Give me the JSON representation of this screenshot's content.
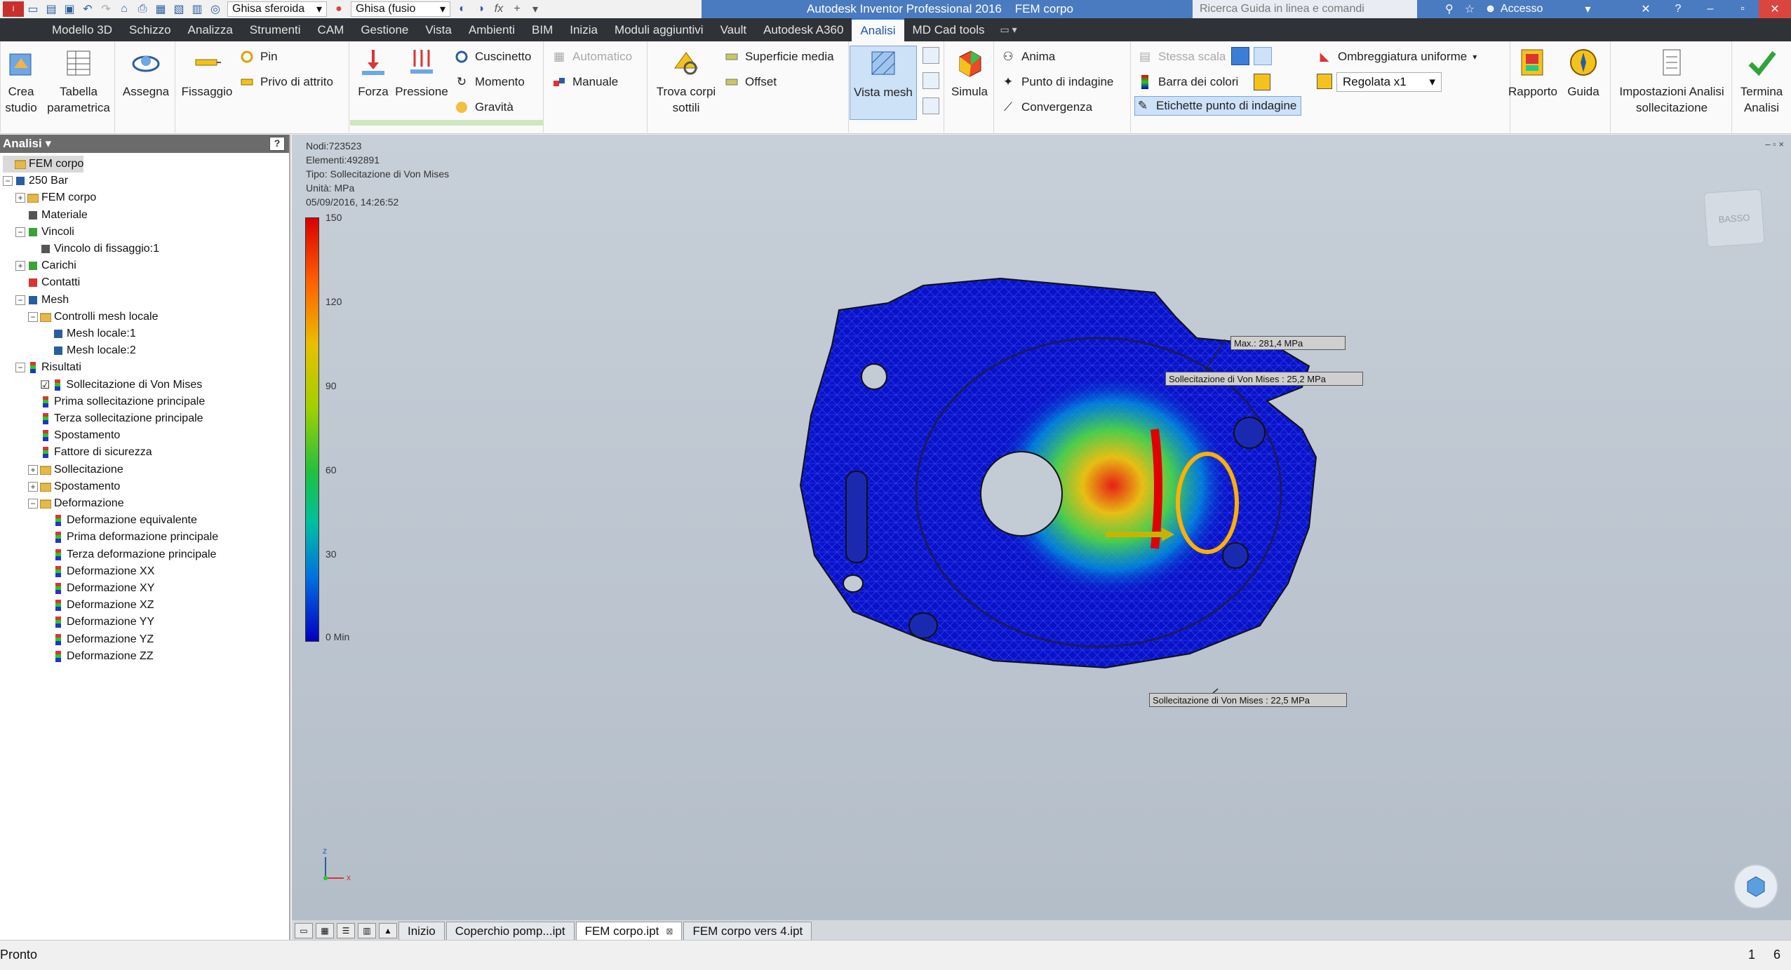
{
  "titlebar": {
    "material": "Ghisa sferoida",
    "appearance": "Ghisa (fusio",
    "app_title": "Autodesk Inventor Professional 2016",
    "document_title": "FEM corpo",
    "help_search_placeholder": "Ricerca Guida in linea e comandi",
    "signin": "Accesso"
  },
  "menu": {
    "tabs": [
      "Modello 3D",
      "Schizzo",
      "Analizza",
      "Strumenti",
      "CAM",
      "Gestione",
      "Vista",
      "Ambienti",
      "BIM",
      "Inizia",
      "Moduli aggiuntivi",
      "Vault",
      "Autodesk A360",
      "Analisi",
      "MD Cad tools"
    ],
    "active_tab": "Analisi"
  },
  "ribbon": {
    "crea_studio": "Crea studio",
    "tabella_parametrica": "Tabella parametrica",
    "assegna": "Assegna",
    "fissaggio": "Fissaggio",
    "pin": "Pin",
    "privo_di_attrito": "Privo di attrito",
    "forza": "Forza",
    "pressione": "Pressione",
    "cuscinetto": "Cuscinetto",
    "momento": "Momento",
    "gravita": "Gravità",
    "automatico": "Automatico",
    "manuale": "Manuale",
    "trova_corpi_sottili": "Trova corpi sottili",
    "superficie_media": "Superficie media",
    "offset": "Offset",
    "vista_mesh": "Vista mesh",
    "simula": "Simula",
    "anima": "Anima",
    "punto_di_indagine": "Punto di indagine",
    "convergenza": "Convergenza",
    "stessa_scala": "Stessa scala",
    "barra_dei_colori": "Barra dei colori",
    "etichette_punto_di_indagine": "Etichette punto di indagine",
    "ombreggiatura_uniforme": "Ombreggiatura uniforme",
    "regolata": "Regolata x1",
    "rapporto": "Rapporto",
    "guida": "Guida",
    "impostazioni_analisi": "Impostazioni Analisi sollecitazione",
    "termina_analisi": "Termina Analisi"
  },
  "browser": {
    "title": "Analisi",
    "help": "?",
    "items": [
      {
        "label": "FEM corpo",
        "depth": 0,
        "exp": "",
        "icon": "folder-icon",
        "selected": true
      },
      {
        "label": "250 Bar",
        "depth": 0,
        "exp": "−",
        "icon": "study-icon"
      },
      {
        "label": "FEM corpo",
        "depth": 1,
        "exp": "+",
        "icon": "folder-icon"
      },
      {
        "label": "Materiale",
        "depth": 1,
        "exp": "",
        "icon": "material-icon"
      },
      {
        "label": "Vincoli",
        "depth": 1,
        "exp": "−",
        "icon": "constraint-icon"
      },
      {
        "label": "Vincolo di fissaggio:1",
        "depth": 2,
        "exp": "",
        "icon": "fixed-constraint-icon"
      },
      {
        "label": "Carichi",
        "depth": 1,
        "exp": "+",
        "icon": "load-icon"
      },
      {
        "label": "Contatti",
        "depth": 1,
        "exp": "",
        "icon": "contact-icon"
      },
      {
        "label": "Mesh",
        "depth": 1,
        "exp": "−",
        "icon": "mesh-icon"
      },
      {
        "label": "Controlli mesh locale",
        "depth": 2,
        "exp": "−",
        "icon": "folder-icon"
      },
      {
        "label": "Mesh locale:1",
        "depth": 3,
        "exp": "",
        "icon": "mesh-icon"
      },
      {
        "label": "Mesh locale:2",
        "depth": 3,
        "exp": "",
        "icon": "mesh-icon"
      },
      {
        "label": "Risultati",
        "depth": 1,
        "exp": "−",
        "icon": "result-icon"
      },
      {
        "label": "Sollecitazione di Von Mises",
        "depth": 2,
        "exp": "",
        "icon": "result-icon",
        "checked": true
      },
      {
        "label": "Prima sollecitazione principale",
        "depth": 2,
        "exp": "",
        "icon": "result-icon"
      },
      {
        "label": "Terza sollecitazione principale",
        "depth": 2,
        "exp": "",
        "icon": "result-icon"
      },
      {
        "label": "Spostamento",
        "depth": 2,
        "exp": "",
        "icon": "result-icon"
      },
      {
        "label": "Fattore di sicurezza",
        "depth": 2,
        "exp": "",
        "icon": "result-icon"
      },
      {
        "label": "Sollecitazione",
        "depth": 2,
        "exp": "+",
        "icon": "folder-icon"
      },
      {
        "label": "Spostamento",
        "depth": 2,
        "exp": "+",
        "icon": "folder-icon"
      },
      {
        "label": "Deformazione",
        "depth": 2,
        "exp": "−",
        "icon": "folder-icon"
      },
      {
        "label": "Deformazione equivalente",
        "depth": 3,
        "exp": "",
        "icon": "result-icon"
      },
      {
        "label": "Prima deformazione principale",
        "depth": 3,
        "exp": "",
        "icon": "result-icon"
      },
      {
        "label": "Terza deformazione principale",
        "depth": 3,
        "exp": "",
        "icon": "result-icon"
      },
      {
        "label": "Deformazione XX",
        "depth": 3,
        "exp": "",
        "icon": "result-icon"
      },
      {
        "label": "Deformazione XY",
        "depth": 3,
        "exp": "",
        "icon": "result-icon"
      },
      {
        "label": "Deformazione XZ",
        "depth": 3,
        "exp": "",
        "icon": "result-icon"
      },
      {
        "label": "Deformazione YY",
        "depth": 3,
        "exp": "",
        "icon": "result-icon"
      },
      {
        "label": "Deformazione YZ",
        "depth": 3,
        "exp": "",
        "icon": "result-icon"
      },
      {
        "label": "Deformazione ZZ",
        "depth": 3,
        "exp": "",
        "icon": "result-icon"
      }
    ]
  },
  "viewport": {
    "info": {
      "nodes": "Nodi:723523",
      "elements": "Elementi:492891",
      "type": "Tipo: Sollecitazione di Von Mises",
      "units": "Unità: MPa",
      "date": "05/09/2016, 14:26:52"
    },
    "legend": {
      "labels": [
        "150",
        "120",
        "90",
        "60",
        "30",
        "0 Min"
      ]
    },
    "probes": {
      "max": "Max.: 281,4 MPa",
      "p1": "Sollecitazione di Von Mises : 25,2 MPa",
      "p2": "Sollecitazione di Von Mises : 22,5 MPa"
    },
    "viewcube": "BASSO",
    "axis_z": "z",
    "axis_x": "x",
    "corner": "– ▫ ×"
  },
  "doctabs": {
    "tabs": [
      "Inizio",
      "Coperchio pomp...ipt",
      "FEM corpo.ipt",
      "FEM corpo vers 4.ipt"
    ],
    "active": "FEM corpo.ipt"
  },
  "status": {
    "text": "Pronto",
    "right1": "1",
    "right2": "6"
  }
}
